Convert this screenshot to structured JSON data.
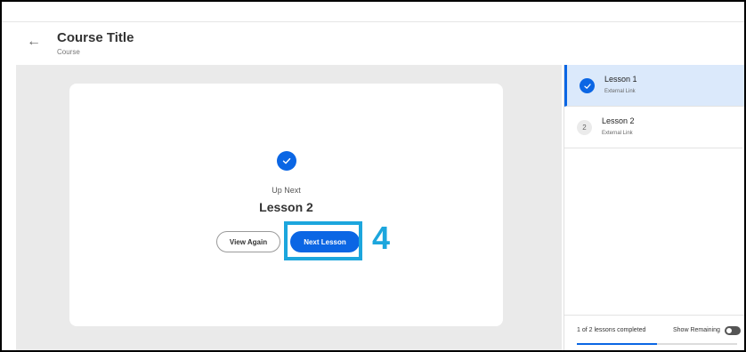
{
  "header": {
    "title": "Course Title",
    "subtitle": "Course"
  },
  "card": {
    "up_next_label": "Up Next",
    "next_lesson_title": "Lesson 2",
    "view_again_label": "View Again",
    "next_lesson_label": "Next Lesson"
  },
  "annotation": {
    "step_number": "4",
    "color": "#1ca6dd"
  },
  "sidebar": {
    "lessons": [
      {
        "number": "1",
        "title": "Lesson 1",
        "type": "External Link",
        "status": "completed"
      },
      {
        "number": "2",
        "title": "Lesson 2",
        "type": "External Link",
        "status": "not-started"
      }
    ],
    "progress_text": "1 of 2 lessons completed",
    "show_remaining_label": "Show Remaining",
    "completed_fraction": 0.5
  },
  "colors": {
    "accent": "#0b66e4",
    "active_item_bg": "#dbe9fb",
    "content_bg": "#eaeaea"
  }
}
